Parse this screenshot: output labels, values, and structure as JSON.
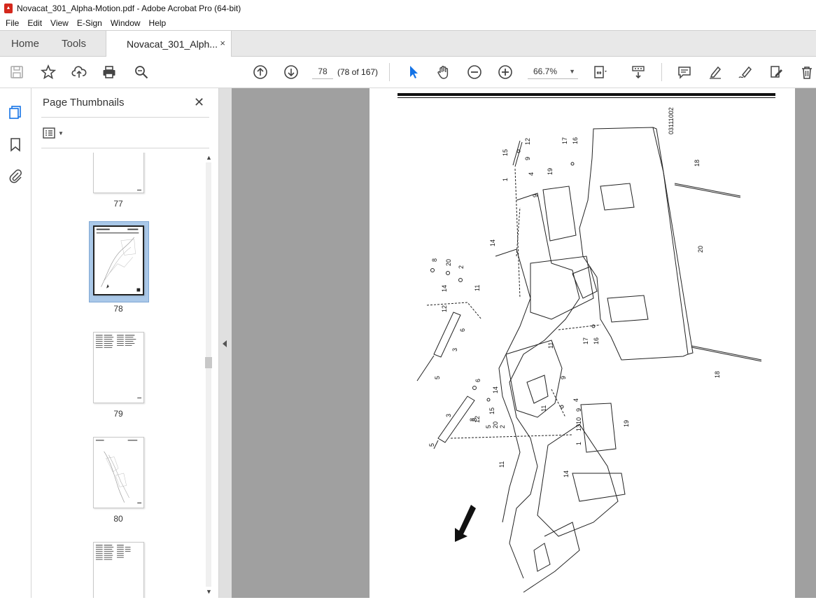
{
  "window": {
    "title": "Novacat_301_Alpha-Motion.pdf - Adobe Acrobat Pro (64-bit)",
    "icon_name": "pdf-file-icon"
  },
  "menu": [
    "File",
    "Edit",
    "View",
    "E-Sign",
    "Window",
    "Help"
  ],
  "tabs": {
    "home": "Home",
    "tools": "Tools",
    "document": "Novacat_301_Alph...",
    "close_glyph": "×"
  },
  "toolbar": {
    "page_number": "78",
    "page_count": "(78 of 167)",
    "zoom": "66.7%",
    "icons": [
      "save-icon",
      "star-icon",
      "upload-icon",
      "print-icon",
      "zoom-search-icon",
      "prev-page-icon",
      "next-page-icon",
      "select-cursor-icon",
      "hand-icon",
      "zoom-out-icon",
      "zoom-in-icon",
      "fit-page-icon",
      "scroll-mode-icon",
      "comment-icon",
      "highlight-icon",
      "sign-icon",
      "edit-pdf-icon",
      "delete-icon"
    ]
  },
  "thumbnails": {
    "title": "Page Thumbnails",
    "close_glyph": "✕",
    "pages": [
      {
        "label": "77"
      },
      {
        "label": "78",
        "selected": true
      },
      {
        "label": "79"
      },
      {
        "label": "80"
      }
    ]
  },
  "document": {
    "drawing_code": "03111002",
    "part_numbers": [
      "1",
      "2",
      "3",
      "4",
      "5",
      "6",
      "8",
      "9",
      "10",
      "11",
      "12",
      "13",
      "14",
      "15",
      "16",
      "17",
      "18",
      "19",
      "20"
    ]
  },
  "colors": {
    "accent": "#1473e6",
    "tab_bar": "#e8e8e8",
    "doc_background": "#a0a0a0",
    "thumb_selection": "#aac8e8"
  }
}
